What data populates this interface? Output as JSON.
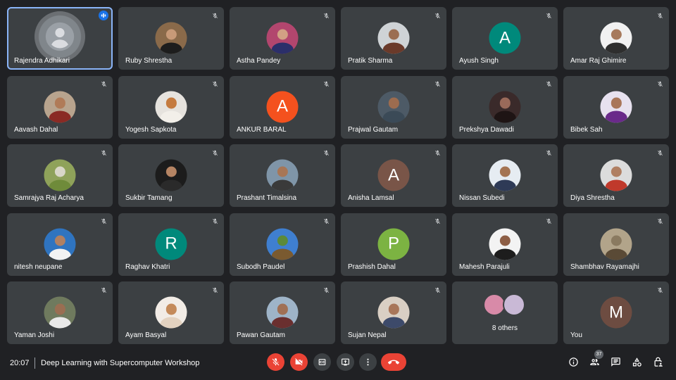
{
  "participants": [
    {
      "name": "Rajendra Adhikari",
      "avatar": "default",
      "speaking": true
    },
    {
      "name": "Ruby Shrestha",
      "avatar": "photo",
      "bg": "#8a6a4a",
      "skin": "#c89a78",
      "cloth": "#1d1d1d"
    },
    {
      "name": "Astha Pandey",
      "avatar": "photo",
      "bg": "#b2466e",
      "skin": "#d2a084",
      "cloth": "#2b2f6a"
    },
    {
      "name": "Pratik Sharma",
      "avatar": "photo",
      "bg": "#cfd3d6",
      "skin": "#9b6e52",
      "cloth": "#6a3a2a"
    },
    {
      "name": "Ayush Singh",
      "avatar": "letter",
      "letter": "A",
      "bg": "#00897b"
    },
    {
      "name": "Amar Raj Ghimire",
      "avatar": "photo",
      "bg": "#f1f1f1",
      "skin": "#a77a5c",
      "cloth": "#2e2e2e"
    },
    {
      "name": "Aavash Dahal",
      "avatar": "photo",
      "bg": "#b8a48e",
      "skin": "#b07b58",
      "cloth": "#8a2a24"
    },
    {
      "name": "Yogesh Sapkota",
      "avatar": "photo",
      "bg": "#e6e3de",
      "skin": "#c57b3f",
      "cloth": "#f2efe9"
    },
    {
      "name": "ANKUR BARAL",
      "avatar": "letter",
      "letter": "A",
      "bg": "#f4511e"
    },
    {
      "name": "Prajwal Gautam",
      "avatar": "photo",
      "bg": "#4d5a66",
      "skin": "#9c6c4f",
      "cloth": "#3b4a57"
    },
    {
      "name": "Prekshya Dawadi",
      "avatar": "photo",
      "bg": "#3a2a2a",
      "skin": "#9a6a5a",
      "cloth": "#1e1414"
    },
    {
      "name": "Bibek Sah",
      "avatar": "photo",
      "bg": "#e7e1ef",
      "skin": "#a9765a",
      "cloth": "#6a2a8a"
    },
    {
      "name": "Samrajya Raj Acharya",
      "avatar": "photo",
      "bg": "#8fa25a",
      "skin": "#d9d7c8",
      "cloth": "#6f8b3a"
    },
    {
      "name": "Sukbir Tamang",
      "avatar": "photo",
      "bg": "#1c1c1c",
      "skin": "#b58463",
      "cloth": "#2a2a2a"
    },
    {
      "name": "Prashant Timalsina",
      "avatar": "photo",
      "bg": "#7f95a8",
      "skin": "#a87656",
      "cloth": "#3a3a3a"
    },
    {
      "name": "Anisha Lamsal",
      "avatar": "letter",
      "letter": "A",
      "bg": "#795548"
    },
    {
      "name": "Nissan Subedi",
      "avatar": "photo",
      "bg": "#e6ecf2",
      "skin": "#a47453",
      "cloth": "#2e3a56"
    },
    {
      "name": "Diya Shrestha",
      "avatar": "photo",
      "bg": "#dcdcdc",
      "skin": "#b07f62",
      "cloth": "#c0392b"
    },
    {
      "name": "nitesh neupane",
      "avatar": "photo",
      "bg": "#2f74c0",
      "skin": "#b08062",
      "cloth": "#f3f3f3"
    },
    {
      "name": "Raghav Khatri",
      "avatar": "letter",
      "letter": "R",
      "bg": "#00897b"
    },
    {
      "name": "Subodh Paudel",
      "avatar": "photo",
      "bg": "#3f7fd0",
      "skin": "#5c8a3a",
      "cloth": "#7a5a30"
    },
    {
      "name": "Prashish Dahal",
      "avatar": "letter",
      "letter": "P",
      "bg": "#7cb342"
    },
    {
      "name": "Mahesh Parajuli",
      "avatar": "photo",
      "bg": "#f3f3f3",
      "skin": "#8d5e45",
      "cloth": "#1d1d1d"
    },
    {
      "name": "Shambhav Rayamajhi",
      "avatar": "photo",
      "bg": "#b2a48a",
      "skin": "#8a7a60",
      "cloth": "#5a4a36"
    },
    {
      "name": "Yaman Joshi",
      "avatar": "photo",
      "bg": "#6f7a5e",
      "skin": "#9a6e52",
      "cloth": "#e9e9e9"
    },
    {
      "name": "Ayam Basyal",
      "avatar": "photo",
      "bg": "#f2ece6",
      "skin": "#c48a5a",
      "cloth": "#e3d2c0"
    },
    {
      "name": "Pawan Gautam",
      "avatar": "photo",
      "bg": "#9eb4c8",
      "skin": "#a07055",
      "cloth": "#6a2f2f"
    },
    {
      "name": "Sujan Nepal",
      "avatar": "photo",
      "bg": "#d9cfc4",
      "skin": "#a8765a",
      "cloth": "#3d4a6a"
    },
    {
      "name": "",
      "avatar": "others",
      "others_label": "8 others"
    },
    {
      "name": "You",
      "avatar": "letter",
      "letter": "M",
      "bg": "#6d4c41"
    }
  ],
  "footer": {
    "time": "20:07",
    "meeting_title": "Deep Learning with Supercomputer Workshop",
    "people_count": "37"
  },
  "controls": {
    "mic": "mic-off-icon",
    "camera": "camera-off-icon",
    "captions": "captions-icon",
    "present": "present-icon",
    "more": "more-options-icon",
    "leave": "leave-call-icon"
  },
  "colors": {
    "background": "#202124",
    "tile": "#3c4043",
    "danger": "#ea4335",
    "active_outline": "#8ab4f8",
    "speaking": "#1a73e8"
  }
}
